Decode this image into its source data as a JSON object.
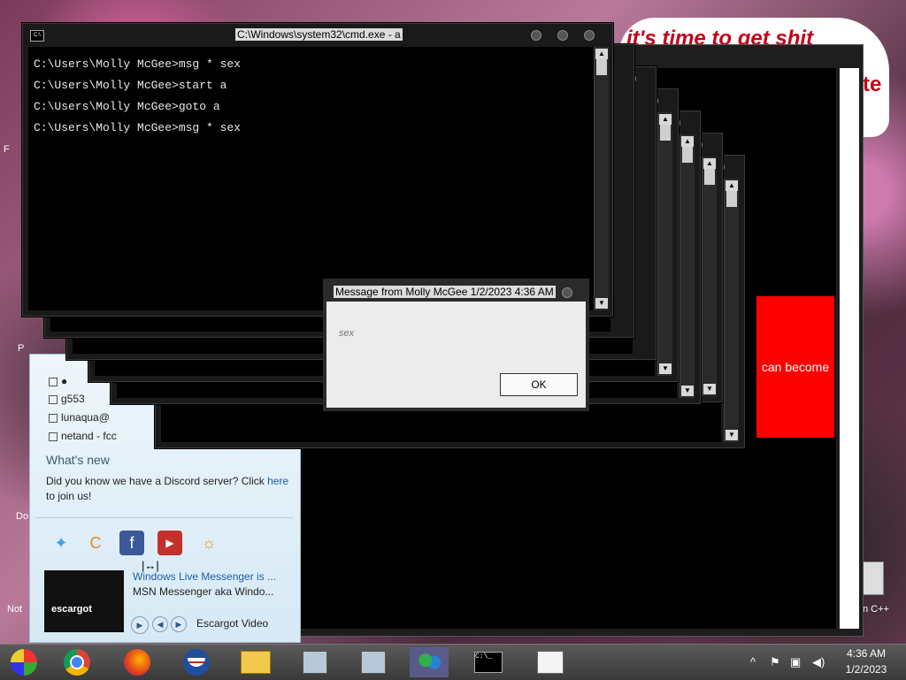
{
  "wallpaper": {
    "callout_text": "it's time to get shit",
    "callout_text2": "te",
    "left_labels": [
      "F",
      "P",
      "Do",
      "Not"
    ],
    "right_label": "n C++"
  },
  "red_panel": {
    "label": "can become"
  },
  "cmd": {
    "title": "C:\\Windows\\system32\\cmd.exe - a",
    "lines": [
      "C:\\Users\\Molly McGee>msg * sex",
      "C:\\Users\\Molly McGee>start a",
      "C:\\Users\\Molly McGee>goto a",
      "C:\\Users\\Molly McGee>msg * sex"
    ]
  },
  "dialog": {
    "title": "Message from Molly McGee 1/2/2023 4:36 AM",
    "message": "sex",
    "ok_label": "OK"
  },
  "messenger": {
    "contacts": [
      "g553",
      "lunaqua@",
      "netand - fcc"
    ],
    "whats_new_title": "What's new",
    "discord_text": "Did you know we have a Discord server? Click",
    "discord_link": "here",
    "discord_suffix": "to join us!",
    "video_title": "Windows Live Messenger is ...",
    "video_subtitle": "MSN Messenger aka Windo...",
    "video_label": "Escargot Video",
    "thumb_label": "escargot"
  },
  "taskbar": {
    "items": [
      "windows-start-icon",
      "chrome-icon",
      "firefox-icon",
      "obama-icon",
      "file-explorer-icon",
      "network-icon",
      "network-icon-2",
      "messenger-icon",
      "cmd-icon",
      "notepad-icon"
    ],
    "clock_time": "4:36 AM",
    "clock_date": "1/2/2023"
  }
}
